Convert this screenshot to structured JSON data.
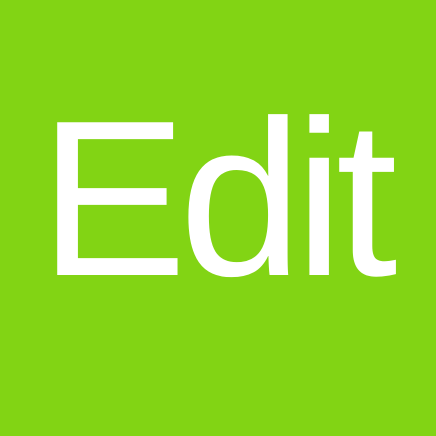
{
  "tile": {
    "label": "Edit",
    "background_color": "#82d414",
    "text_color": "#ffffff"
  }
}
